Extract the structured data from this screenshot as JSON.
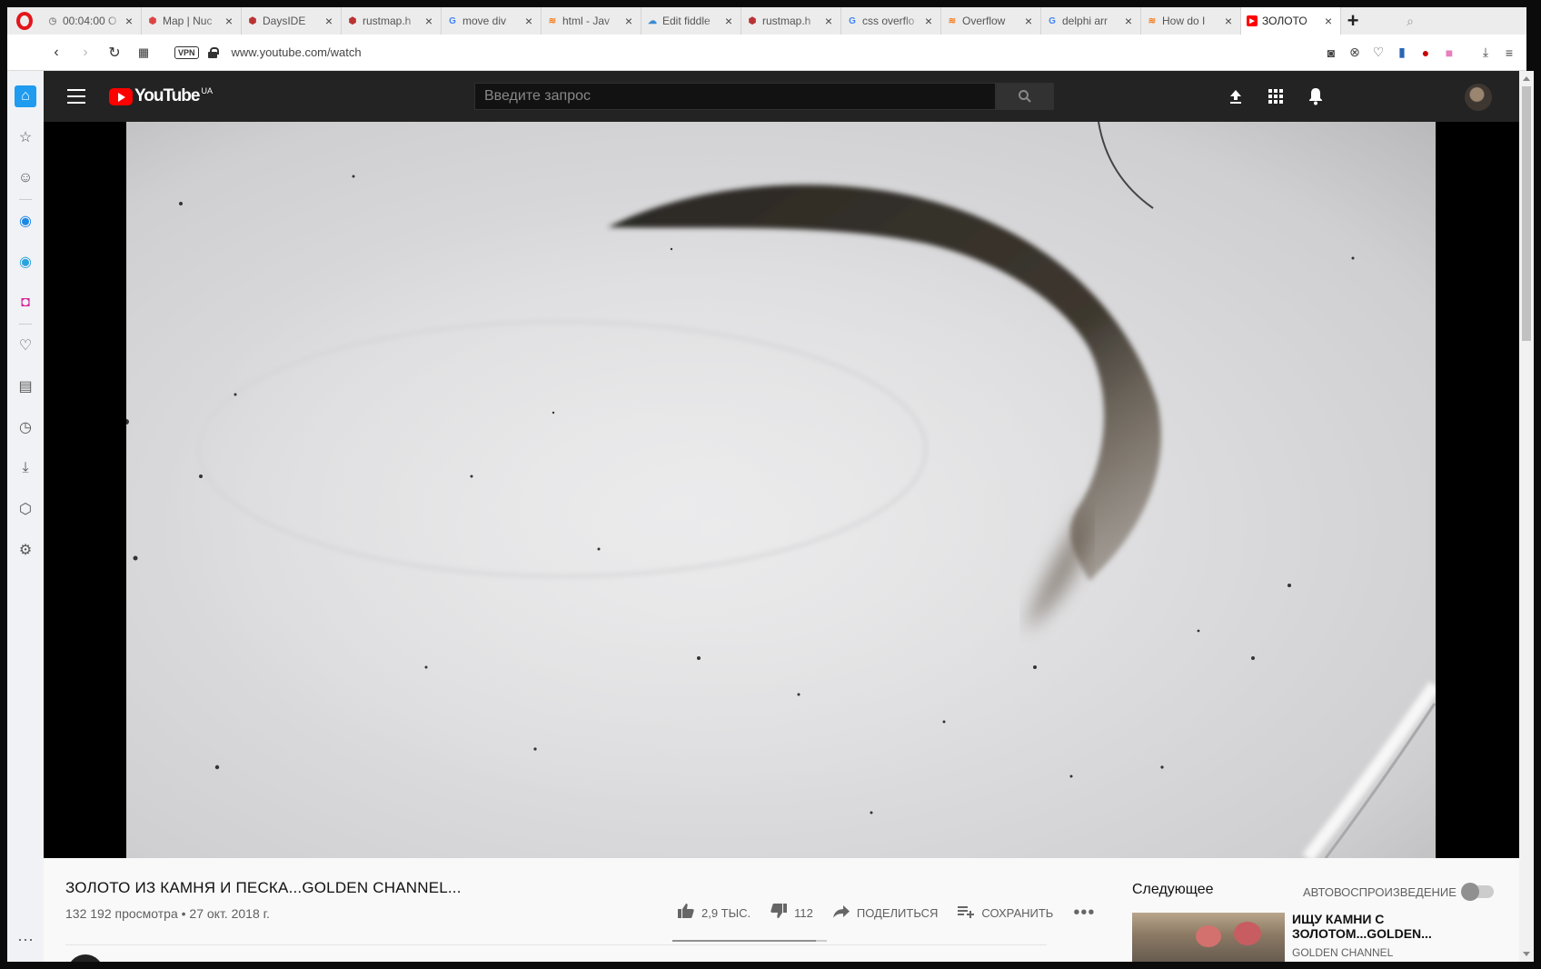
{
  "browser": {
    "tabs": [
      {
        "label": "00:04:00 O",
        "icon": "clock-icon",
        "color": "#888"
      },
      {
        "label": "Map | Nuc",
        "icon": "map-icon",
        "color": "#d44"
      },
      {
        "label": "DaysIDE",
        "icon": "rust-icon",
        "color": "#b33"
      },
      {
        "label": "rustmap.h",
        "icon": "rust-icon",
        "color": "#b33"
      },
      {
        "label": "move div",
        "icon": "google-icon",
        "color": "#4285f4"
      },
      {
        "label": "html - Jav",
        "icon": "stackoverflow-icon",
        "color": "#f48024"
      },
      {
        "label": "Edit fiddle",
        "icon": "jsfiddle-icon",
        "color": "#3a8cd6"
      },
      {
        "label": "rustmap.h",
        "icon": "rust-icon",
        "color": "#b33"
      },
      {
        "label": "css overflo",
        "icon": "google-icon",
        "color": "#4285f4"
      },
      {
        "label": "Overflow",
        "icon": "stackoverflow-icon",
        "color": "#f48024"
      },
      {
        "label": "delphi arr",
        "icon": "google-icon",
        "color": "#4285f4"
      },
      {
        "label": "How do I",
        "icon": "stackoverflow-icon",
        "color": "#f48024"
      },
      {
        "label": "ЗОЛОТО",
        "icon": "youtube-icon",
        "color": "#f00",
        "active": true
      }
    ],
    "url": "www.youtube.com/watch",
    "vpn_label": "VPN"
  },
  "youtube": {
    "logo_text": "YouTube",
    "region": "UA",
    "search_placeholder": "Введите запрос"
  },
  "video": {
    "title": "ЗОЛОТО ИЗ КАМНЯ И ПЕСКА...GOLDEN CHANNEL...",
    "meta": "132 192 просмотра • 27 окт. 2018 г.",
    "likes": "2,9 тыс.",
    "dislikes": "112",
    "share_label": "Поделиться",
    "save_label": "Сохранить",
    "like_ratio": 0.93
  },
  "upnext": {
    "label": "Следующее",
    "autoplay_label": "Автовоспроизведение",
    "items": [
      {
        "title": "ИЩУ КАМНИ С ЗОЛОТОМ...GOLDEN...",
        "channel": "GOLDEN CHANNEL"
      }
    ]
  }
}
